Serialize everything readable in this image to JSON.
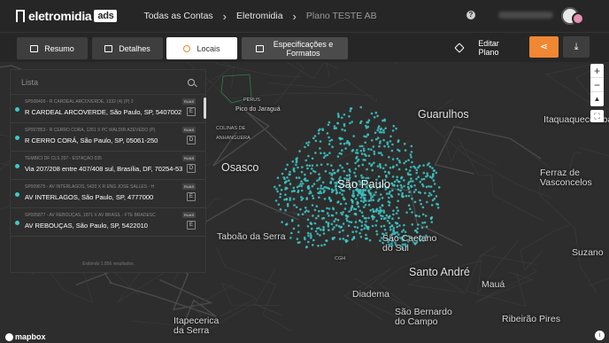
{
  "header": {
    "logo_text": "eletromidia",
    "logo_badge": "ads",
    "breadcrumbs": [
      "Todas as Contas",
      "Eletromidia",
      "Plano TESTE AB"
    ],
    "help_icon": "question-icon"
  },
  "tabs": [
    {
      "label": "Resumo",
      "icon": "briefcase-icon"
    },
    {
      "label": "Detalhes",
      "icon": "list-icon"
    },
    {
      "label": "Locais",
      "icon": "pin-icon"
    },
    {
      "label": "Especificações e Formatos",
      "icon": "layout-icon"
    }
  ],
  "actions": {
    "edit_label": "Editar Plano",
    "share_icon": "share-icon",
    "download_icon": "download-icon"
  },
  "panel": {
    "search_placeholder": "Lista",
    "rows": [
      {
        "code": "SP008400 - R CARDEAL ARCOVERDE, 1332 (4) (P) 2",
        "address": "R CARDEAL ARCOVERDE, São Paulo, SP, 5407002",
        "tag": "RUAS",
        "marker": "E"
      },
      {
        "code": "SP007853 - R CERRO CORÁ, 1261 X PC WALDIR AZEVEDO (P)",
        "address": "R CERRO CORÁ, São Paulo, SP, 05061-250",
        "tag": "RUAS",
        "marker": "D"
      },
      {
        "code": "TEMBICI DF CLS 207 - ESTAÇÃO 035",
        "address": "Via 207/208 entre 407/408 sul, Brasília, DF, 70254-530",
        "tag": "RUAS",
        "marker": "D"
      },
      {
        "code": "SP009675 - AV INTERLAGOS, 5420 X R ENG JOSÉ SALLES - H",
        "address": "AV INTERLAGOS, São Paulo, SP, 4777000",
        "tag": "RUAS",
        "marker": "E"
      },
      {
        "code": "SP005877 - AV REBOUÇAS, 1871 X AV BRASIL - FTE BRADESC",
        "address": "AV REBOUÇAS, São Paulo, SP, 5422010",
        "tag": "RUAS",
        "marker": "E"
      }
    ],
    "footer": "Exibindo 1.856 resultados"
  },
  "map": {
    "places": [
      {
        "name": "Pico do Jaraguá",
        "size": "medium"
      },
      {
        "name": "Guarulhos",
        "size": "big"
      },
      {
        "name": "Itaquaquecetuba",
        "size": "medium"
      },
      {
        "name": "Osasco",
        "size": "big"
      },
      {
        "name": "São Paulo",
        "size": "big"
      },
      {
        "name": "Ferraz de Vasconcelos",
        "size": "medium"
      },
      {
        "name": "Taboão da Serra",
        "size": "medium"
      },
      {
        "name": "São Caetano do Sul",
        "size": "medium"
      },
      {
        "name": "Santo André",
        "size": "big"
      },
      {
        "name": "Mauá",
        "size": "medium"
      },
      {
        "name": "Diadema",
        "size": "medium"
      },
      {
        "name": "São Bernardo do Campo",
        "size": "medium"
      },
      {
        "name": "Ribeirão Pires",
        "size": "medium"
      },
      {
        "name": "Itapecerica da Serra",
        "size": "medium"
      },
      {
        "name": "Suzano",
        "size": "medium"
      },
      {
        "name": "CGH",
        "size": "small"
      },
      {
        "name": "COLINAS DE ANHANGUERA",
        "size": "small"
      },
      {
        "name": "PERUS",
        "size": "small"
      }
    ],
    "marker_color": "#3ec9c9",
    "attribution": "mapbox",
    "zoom_in": "+",
    "zoom_out": "−"
  },
  "colors": {
    "accent": "#ef8733",
    "marker": "#3ec9c9",
    "background": "#2d2d2d"
  }
}
